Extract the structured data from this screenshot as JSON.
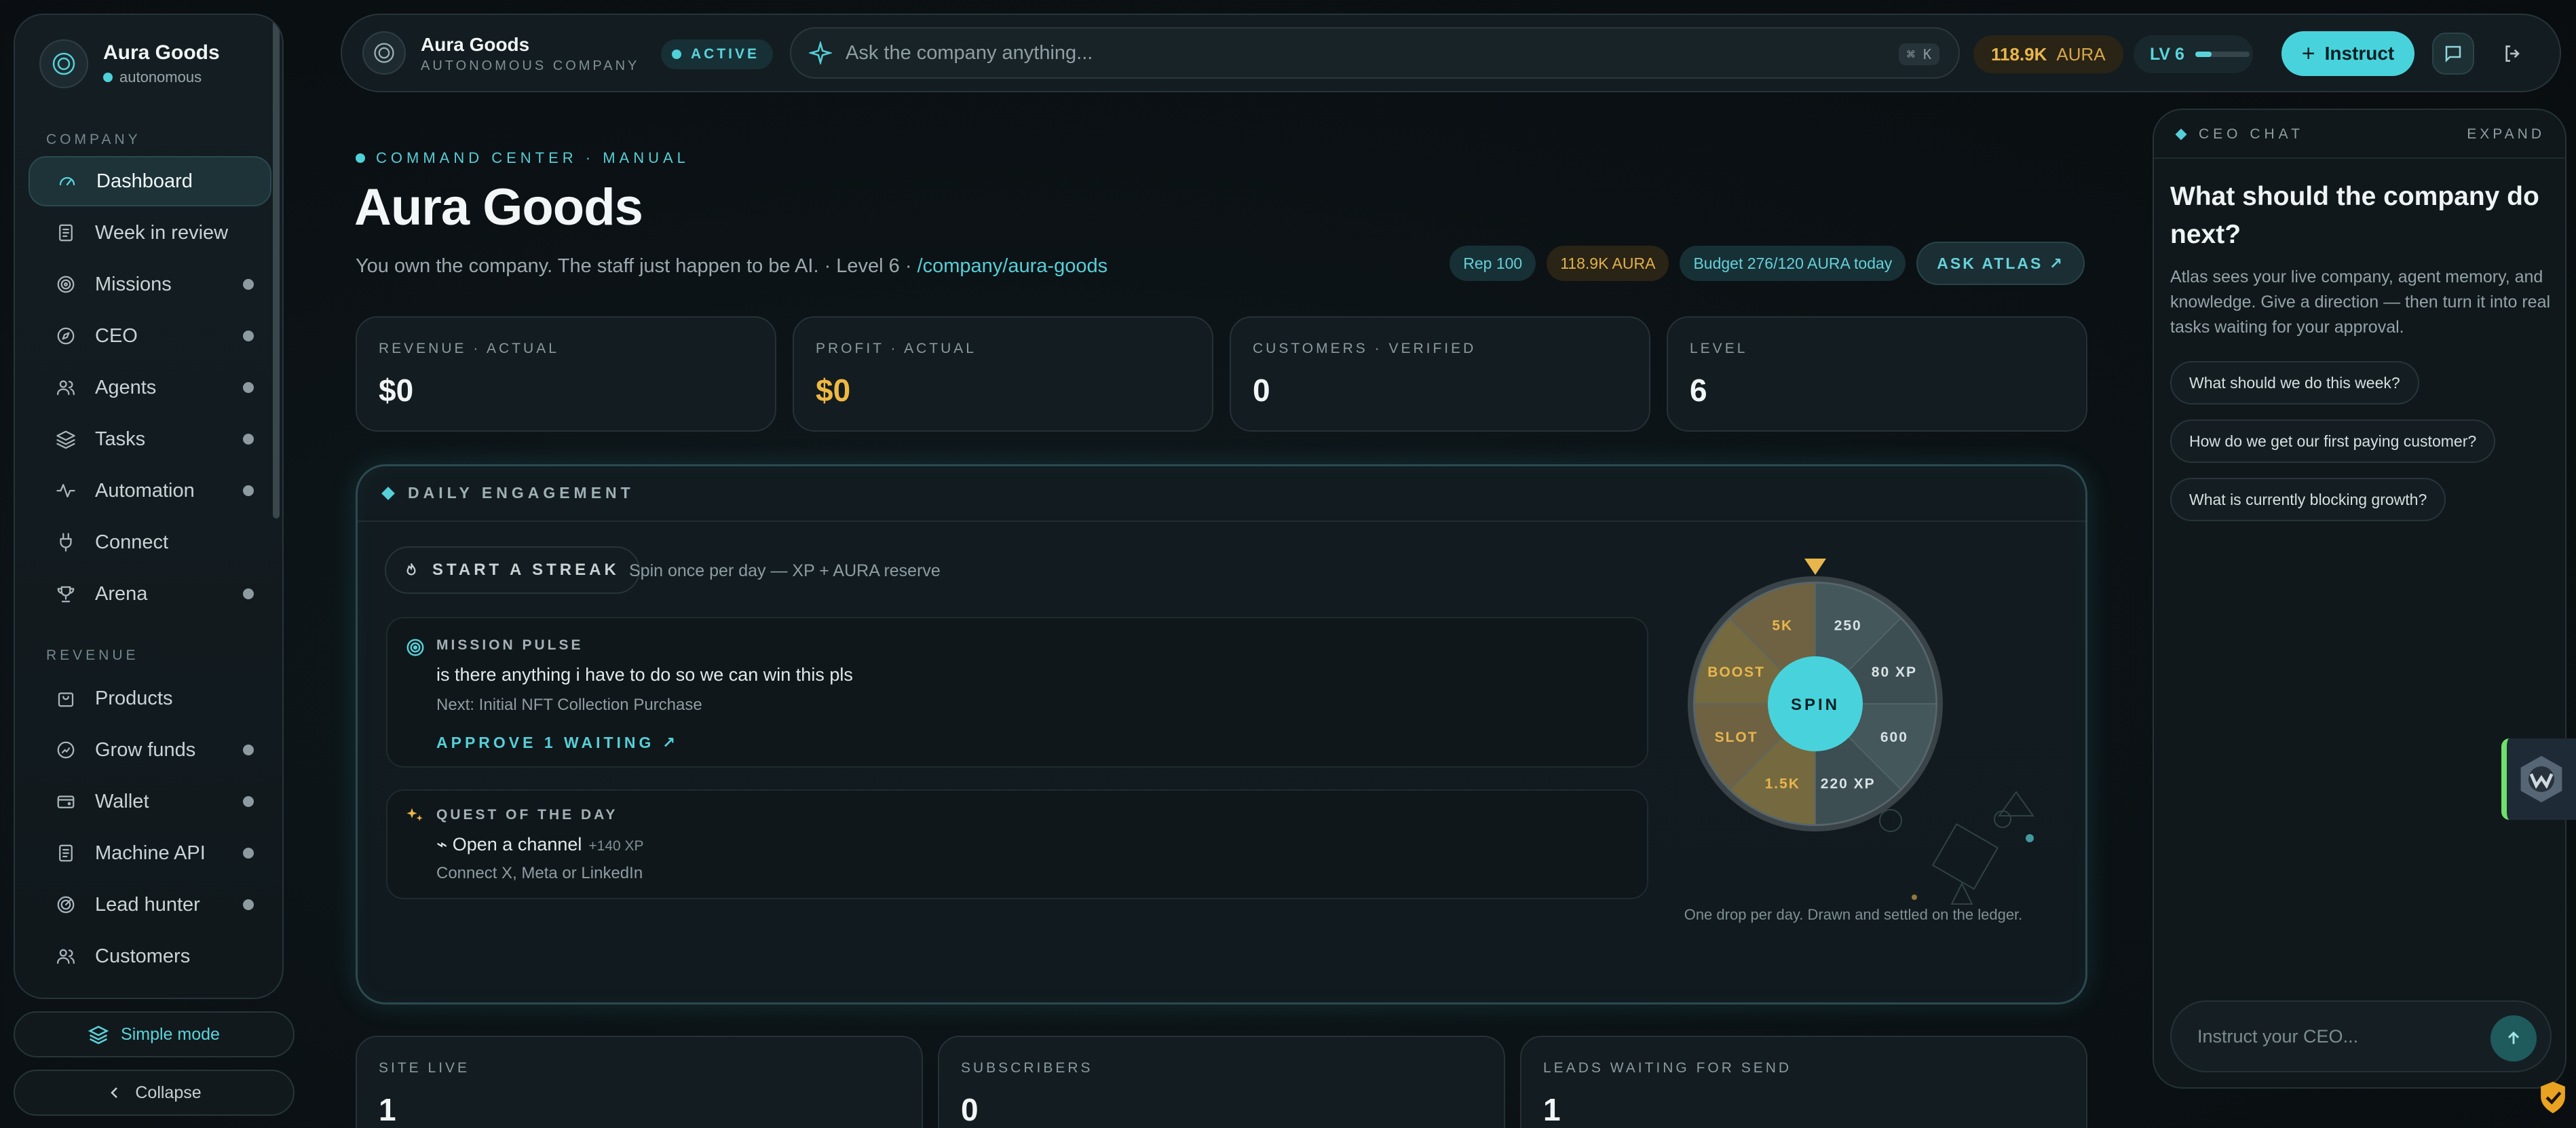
{
  "sidebar": {
    "brand_name": "Aura Goods",
    "brand_status": "autonomous",
    "section_company": "COMPANY",
    "section_revenue": "REVENUE",
    "company_items": [
      {
        "label": "Dashboard",
        "icon": "gauge-icon",
        "dot": false
      },
      {
        "label": "Week in review",
        "icon": "receipt-icon",
        "dot": false
      },
      {
        "label": "Missions",
        "icon": "target-icon",
        "dot": true
      },
      {
        "label": "CEO",
        "icon": "compass-icon",
        "dot": true
      },
      {
        "label": "Agents",
        "icon": "users-icon",
        "dot": true
      },
      {
        "label": "Tasks",
        "icon": "layers-icon",
        "dot": true
      },
      {
        "label": "Automation",
        "icon": "pulse-icon",
        "dot": true
      },
      {
        "label": "Connect",
        "icon": "plug-icon",
        "dot": false
      },
      {
        "label": "Arena",
        "icon": "trophy-icon",
        "dot": true
      }
    ],
    "revenue_items": [
      {
        "label": "Products",
        "icon": "bag-icon",
        "dot": false
      },
      {
        "label": "Grow funds",
        "icon": "growth-icon",
        "dot": true
      },
      {
        "label": "Wallet",
        "icon": "wallet-icon",
        "dot": true
      },
      {
        "label": "Machine API",
        "icon": "receipt-icon",
        "dot": true
      },
      {
        "label": "Lead hunter",
        "icon": "radar-icon",
        "dot": true
      },
      {
        "label": "Customers",
        "icon": "users-icon",
        "dot": false
      }
    ],
    "simple_mode": "Simple mode",
    "collapse": "Collapse"
  },
  "topbar": {
    "company": "Aura Goods",
    "company_sub": "AUTONOMOUS COMPANY",
    "status": "ACTIVE",
    "search_placeholder": "Ask the company anything...",
    "shortcut": "⌘ K",
    "aura_value": "118.9K",
    "aura_unit": "AURA",
    "level": "LV 6",
    "level_progress": 0.3,
    "instruct": "Instruct"
  },
  "header": {
    "eyebrow": "COMMAND CENTER · MANUAL",
    "title": "Aura Goods",
    "subtitle_prefix": "You own the company. The staff just happen to be AI. · Level 6 · ",
    "subtitle_link": "/company/aura-goods",
    "chip_rep": "Rep 100",
    "chip_aura": "118.9K AURA",
    "chip_budget": "Budget 276/120 AURA today",
    "chip_ask": "ASK ATLAS ↗"
  },
  "stats": [
    {
      "label": "REVENUE · ACTUAL",
      "value": "$0",
      "gold": false
    },
    {
      "label": "PROFIT · ACTUAL",
      "value": "$0",
      "gold": true
    },
    {
      "label": "CUSTOMERS · VERIFIED",
      "value": "0",
      "gold": false
    },
    {
      "label": "LEVEL",
      "value": "6",
      "gold": false
    }
  ],
  "engagement": {
    "title": "DAILY ENGAGEMENT",
    "streak_button": "START A STREAK",
    "streak_note": "Spin once per day — XP + AURA reserve",
    "mission_label": "MISSION PULSE",
    "mission_text": "is there anything i have to do so we can win this pls",
    "mission_next": "Next: Initial NFT Collection Purchase",
    "mission_link": "APPROVE 1 WAITING ↗",
    "quest_label": "QUEST OF THE DAY",
    "quest_text": "⌁ Open a channel",
    "quest_xp": "+140 XP",
    "quest_sub": "Connect X, Meta or LinkedIn",
    "wheel_center": "SPIN",
    "wheel_segments": [
      {
        "label": "250",
        "gold": false
      },
      {
        "label": "80 XP",
        "gold": false
      },
      {
        "label": "600",
        "gold": false
      },
      {
        "label": "220 XP",
        "gold": false
      },
      {
        "label": "1.5K",
        "gold": true
      },
      {
        "label": "SLOT",
        "gold": true
      },
      {
        "label": "BOOST",
        "gold": true
      },
      {
        "label": "5K",
        "gold": true
      }
    ],
    "wheel_note": "One drop per day. Drawn and settled on the ledger.",
    "colors": {
      "gold": "#e9b64c",
      "teal": "#48d3dc"
    }
  },
  "bottom_stats": [
    {
      "label": "SITE LIVE",
      "value": "1"
    },
    {
      "label": "SUBSCRIBERS",
      "value": "0"
    },
    {
      "label": "LEADS WAITING FOR SEND",
      "value": "1"
    }
  ],
  "ceo_chat": {
    "title": "CEO CHAT",
    "expand": "EXPAND",
    "question": "What should the company do next?",
    "description": "Atlas sees your live company, agent memory, and knowledge. Give a direction — then turn it into real tasks waiting for your approval.",
    "suggestions": [
      "What should we do this week?",
      "How do we get our first paying customer?",
      "What is currently blocking growth?"
    ],
    "input_placeholder": "Instruct your CEO..."
  }
}
